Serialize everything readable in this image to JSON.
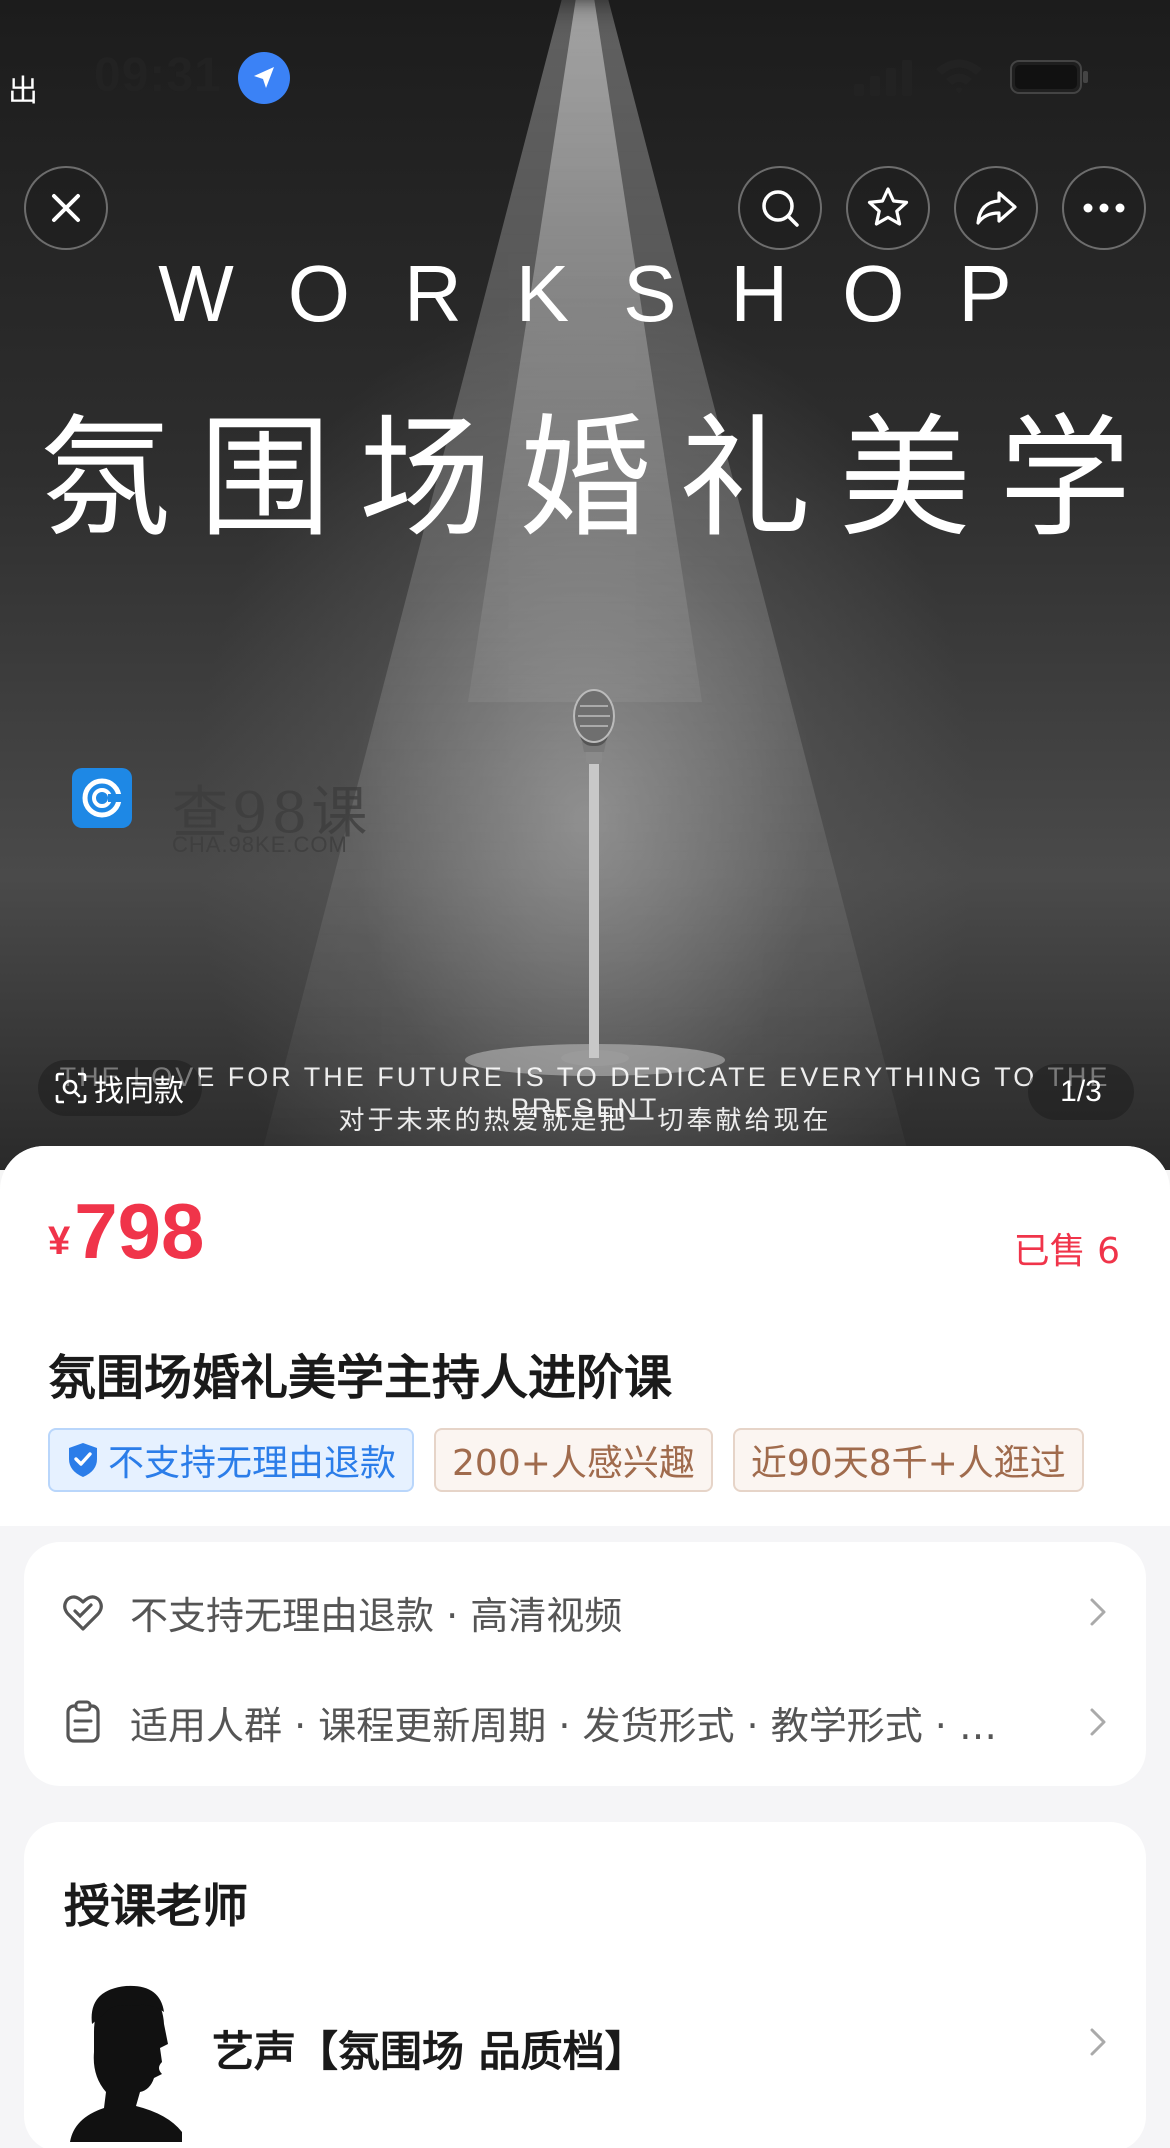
{
  "status_bar": {
    "back_app": "出",
    "time": "09:31"
  },
  "hero": {
    "heading_en": "WORKSHOP",
    "heading_cn": "氛围场婚礼美学",
    "watermark_name": "查98课",
    "watermark_url": "CHA.98KE.COM",
    "tagline_en": "THE LOVE FOR THE FUTURE IS TO DEDICATE EVERYTHING TO THE PRESENT",
    "tagline_cn": "对于未来的热爱就是把一切奉献给现在",
    "find_same_label": "找同款",
    "page_indicator": "1/3"
  },
  "toolbar": {
    "close_icon": "close-icon",
    "search_icon": "search-icon",
    "favorite_icon": "star-icon",
    "share_icon": "share-icon",
    "more_icon": "more-icon"
  },
  "product": {
    "currency": "¥",
    "price": "798",
    "sold": "已售 6",
    "title": "氛围场婚礼美学主持人进阶课",
    "tags": [
      {
        "label": "不支持无理由退款",
        "style": "blue"
      },
      {
        "label": "200+人感兴趣",
        "style": "brown"
      },
      {
        "label": "近90天8千+人逛过",
        "style": "brown"
      }
    ]
  },
  "info": {
    "service_row": "不支持无理由退款 · 高清视频",
    "params_row": "适用人群 · 课程更新周期 · 发货形式 · 教学形式 · …"
  },
  "teacher": {
    "heading": "授课老师",
    "name": "艺声【氛围场 品质档】"
  },
  "colors": {
    "price_red": "#f0344a",
    "tag_blue": "#2b7de9",
    "tag_brown": "#a06b4d"
  }
}
